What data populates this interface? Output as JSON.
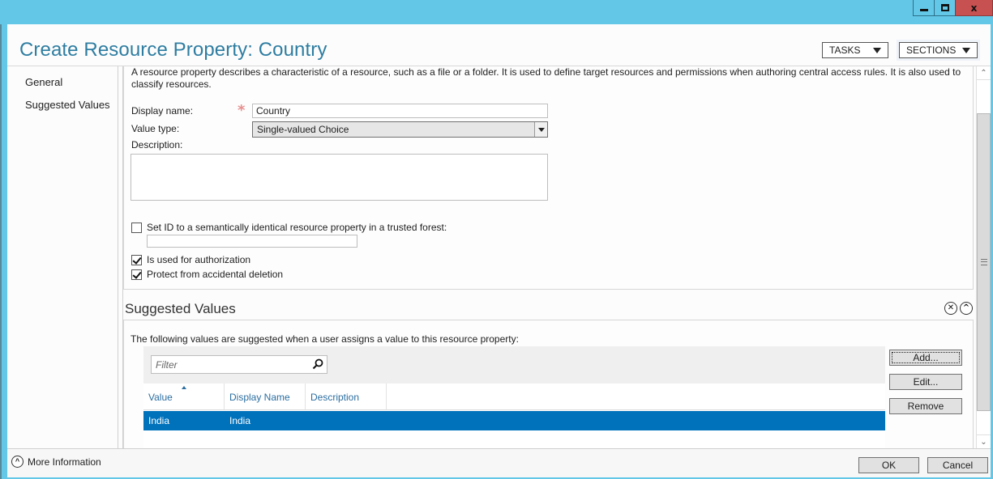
{
  "window": {
    "minimize_label": "minimize",
    "maximize_label": "maximize",
    "close_glyph": "x"
  },
  "header": {
    "title": "Create Resource Property: Country",
    "tasks_label": "TASKS",
    "sections_label": "SECTIONS"
  },
  "nav": {
    "items": [
      {
        "label": "General"
      },
      {
        "label": "Suggested Values"
      }
    ]
  },
  "general": {
    "intro": "A resource property describes a characteristic of a resource, such as a file or a folder. It is used to define target resources and permissions when authoring central access rules. It is also used to classify resources.",
    "display_name_label": "Display name:",
    "display_name_value": "Country",
    "required_marker": "*",
    "value_type_label": "Value type:",
    "value_type_value": "Single-valued Choice",
    "description_label": "Description:",
    "description_value": "",
    "set_id_label": "Set ID to a semantically identical resource property in a trusted forest:",
    "set_id_checked": false,
    "set_id_value": "",
    "authorization_label": "Is used for authorization",
    "authorization_checked": true,
    "protect_label": "Protect from accidental deletion",
    "protect_checked": true
  },
  "suggested_values": {
    "title": "Suggested Values",
    "intro": "The following values are suggested when a user assigns a value to this resource property:",
    "filter_placeholder": "Filter",
    "columns": [
      "Value",
      "Display Name",
      "Description"
    ],
    "rows": [
      {
        "value": "India",
        "display_name": "India",
        "description": "",
        "selected": true
      }
    ],
    "add_label": "Add...",
    "edit_label": "Edit...",
    "remove_label": "Remove",
    "close_icon_glyph": "✕",
    "collapse_icon_glyph": "^"
  },
  "footer": {
    "more_info_label": "More Information",
    "ok_label": "OK",
    "cancel_label": "Cancel"
  },
  "colors": {
    "accent": "#2e7da1",
    "selection": "#0072bc",
    "chrome": "#63c8e8",
    "close": "#c75050",
    "required": "#e88f8f"
  }
}
